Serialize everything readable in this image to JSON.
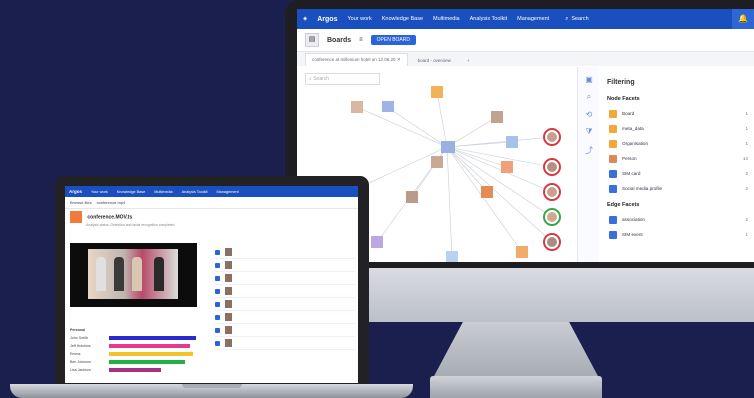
{
  "monitor": {
    "nav": {
      "logo": "Argos",
      "items": [
        "Your work",
        "Knowledge Base",
        "Multimedia",
        "Analysis Toolkit",
        "Management"
      ],
      "search": "Search"
    },
    "subheader": {
      "title": "Boards",
      "button": "OPEN BOARD"
    },
    "tabs": [
      "conference at millenium hotel on 12.06.20",
      "board - overview"
    ],
    "graph_search": "Search",
    "toolbar_icons": [
      "view-icon",
      "search-icon",
      "layout-icon",
      "filter-icon",
      "share-icon"
    ],
    "filter": {
      "title": "Filtering",
      "node_section": "Node Facets",
      "nodes": [
        {
          "label": "Board",
          "count": "1",
          "color": "#f2a93b"
        },
        {
          "label": "meta_data",
          "count": "1",
          "color": "#f2a93b"
        },
        {
          "label": "Organisation",
          "count": "1",
          "color": "#f2a93b"
        },
        {
          "label": "Person",
          "count": "14",
          "color": "#d98a5a"
        },
        {
          "label": "SIM card",
          "count": "2",
          "color": "#3b6fd9"
        },
        {
          "label": "Social media profile",
          "count": "2",
          "color": "#3b6fd9"
        }
      ],
      "edge_section": "Edge Facets",
      "edges": [
        {
          "label": "association",
          "count": "2",
          "color": "#3b6fd9"
        },
        {
          "label": "SIM event",
          "count": "1",
          "color": "#3b6fd9"
        }
      ]
    }
  },
  "laptop": {
    "nav": {
      "logo": "Argos",
      "items": [
        "Your work",
        "Knowledge Base",
        "Multimedia",
        "Analysis Toolkit",
        "Management"
      ]
    },
    "sub": [
      "Browse files",
      "conference.mp4"
    ],
    "title": "conference.MOV.ts",
    "subtitle": "Analysis status: Detection and facial recognition completed",
    "timeline": {
      "rows": [
        {
          "label": "Personal",
          "color": "#ffffff",
          "value": 0
        },
        {
          "label": "John Smith",
          "color": "#2a2ad0",
          "value": 0.92
        },
        {
          "label": "Jeff Hutchins",
          "color": "#e43a8c",
          "value": 0.85
        },
        {
          "label": "Emma",
          "color": "#f5c22b",
          "value": 0.88
        },
        {
          "label": "Ben Johnson",
          "color": "#22b046",
          "value": 0.8
        },
        {
          "label": "Lisa Jackson",
          "color": "#a4327f",
          "value": 0.55
        }
      ]
    },
    "people_table": {
      "rows": 8
    }
  }
}
